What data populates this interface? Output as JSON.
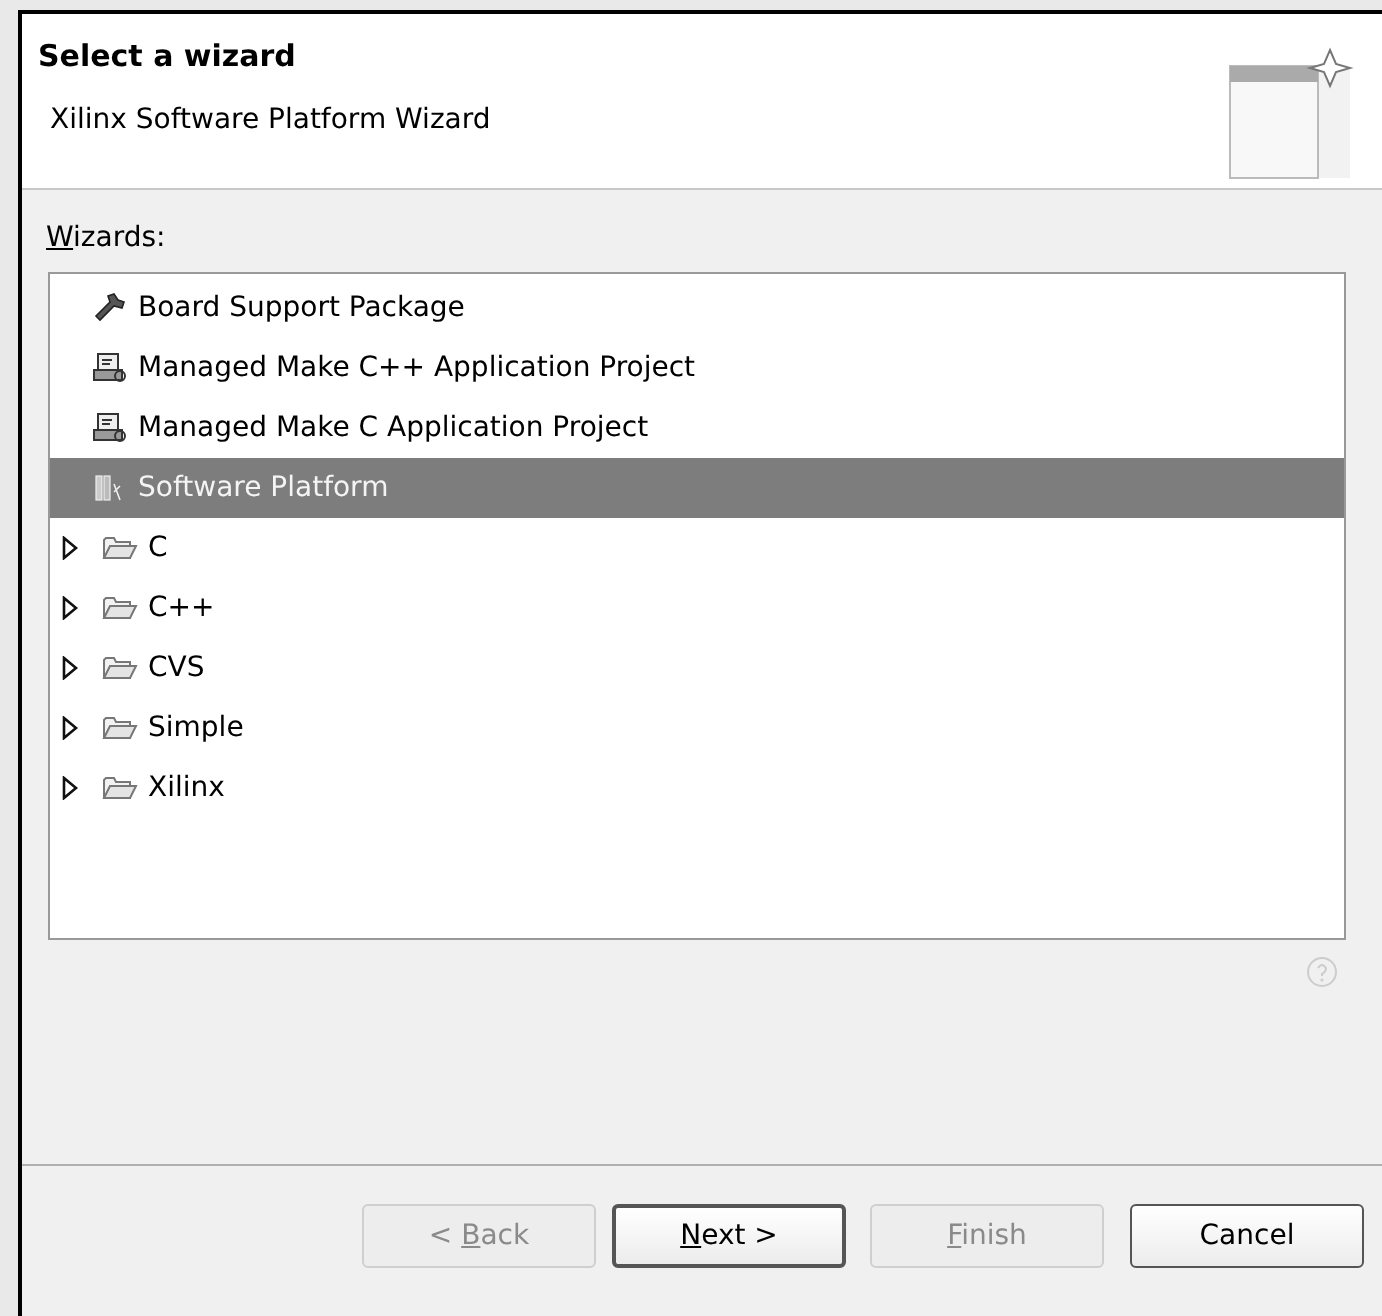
{
  "header": {
    "title": "Select a wizard",
    "subtitle": "Xilinx Software Platform Wizard"
  },
  "wizards_label": {
    "mnemonic": "W",
    "rest": "izards:"
  },
  "tree": [
    {
      "kind": "tool",
      "label": "Board Support Package",
      "selected": false
    },
    {
      "kind": "cpp-project",
      "label": "Managed Make C++ Application Project",
      "selected": false
    },
    {
      "kind": "c-project",
      "label": "Managed Make C Application Project",
      "selected": false
    },
    {
      "kind": "platform",
      "label": "Software Platform",
      "selected": true
    },
    {
      "kind": "folder",
      "label": "C",
      "selected": false,
      "expanded": false
    },
    {
      "kind": "folder",
      "label": "C++",
      "selected": false,
      "expanded": false
    },
    {
      "kind": "folder",
      "label": "CVS",
      "selected": false,
      "expanded": false
    },
    {
      "kind": "folder",
      "label": "Simple",
      "selected": false,
      "expanded": false
    },
    {
      "kind": "folder",
      "label": "Xilinx",
      "selected": false,
      "expanded": false
    }
  ],
  "buttons": [
    {
      "pre": "< ",
      "mnemonic": "B",
      "rest": "ack",
      "disabled": true,
      "default": false
    },
    {
      "mnemonic": "N",
      "rest": "ext >",
      "disabled": false,
      "default": true
    },
    {
      "mnemonic": "F",
      "rest": "inish",
      "disabled": true,
      "default": false
    },
    {
      "rest": "Cancel",
      "disabled": false,
      "default": false
    }
  ]
}
